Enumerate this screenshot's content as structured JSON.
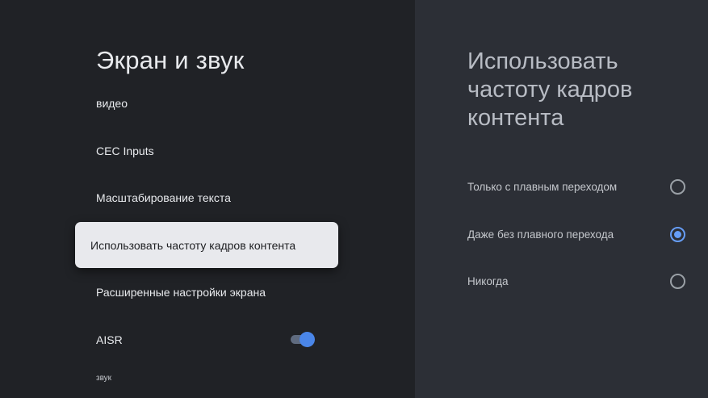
{
  "left": {
    "title": "Экран и звук",
    "items": [
      {
        "label": "видео"
      },
      {
        "label": "CEC Inputs"
      },
      {
        "label": "Масштабирование текста"
      },
      {
        "label": "Использовать частоту кадров контента"
      },
      {
        "label": "Расширенные настройки экрана"
      },
      {
        "label": "AISR",
        "toggle_on": true
      }
    ],
    "section_header": "звук"
  },
  "right": {
    "title": "Использовать частоту кадров контента",
    "options": [
      {
        "label": "Только с плавным переходом",
        "selected": false
      },
      {
        "label": "Даже без плавного перехода",
        "selected": true
      },
      {
        "label": "Никогда",
        "selected": false
      }
    ]
  },
  "colors": {
    "background": "#202226",
    "panel": "#2c2f36",
    "focus": "#e8e9ed",
    "accent": "#669df6"
  }
}
